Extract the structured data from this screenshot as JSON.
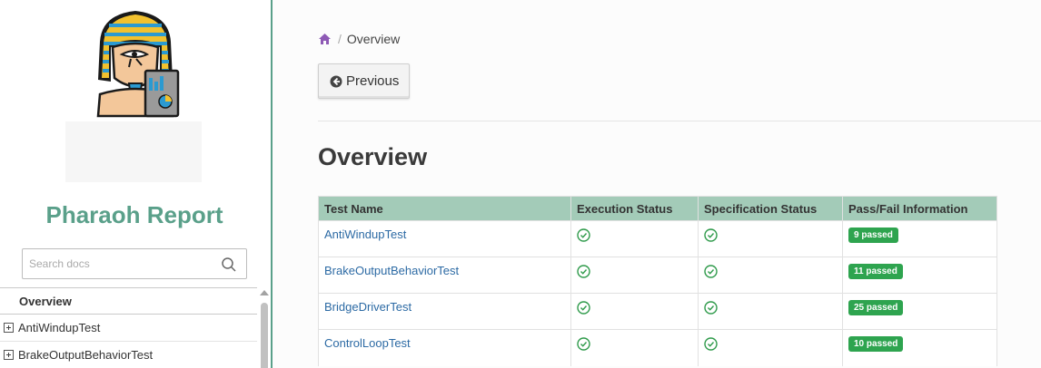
{
  "sidebar": {
    "project_name": "Pharaoh Report",
    "search_placeholder": "Search docs",
    "current_item": "Overview",
    "items": [
      {
        "label": "AntiWindupTest"
      },
      {
        "label": "BrakeOutputBehaviorTest"
      }
    ]
  },
  "breadcrumb": {
    "separator": "/",
    "current": "Overview"
  },
  "nav_buttons": {
    "previous_label": "Previous"
  },
  "page": {
    "title": "Overview"
  },
  "table": {
    "headers": [
      "Test Name",
      "Execution Status",
      "Specification Status",
      "Pass/Fail Information"
    ],
    "rows": [
      {
        "name": "AntiWindupTest",
        "badge": "9 passed"
      },
      {
        "name": "BrakeOutputBehaviorTest",
        "badge": "11 passed"
      },
      {
        "name": "BridgeDriverTest",
        "badge": "25 passed"
      },
      {
        "name": "ControlLoopTest",
        "badge": "10 passed"
      }
    ]
  },
  "colors": {
    "accent": "#5aa08a",
    "header_bg": "#a3cbb8",
    "badge_green": "#2ea44f",
    "link": "#2c6aa4",
    "breadcrumb_home": "#8e5ab5"
  },
  "icons": [
    "pharaoh-logo",
    "search-icon",
    "home-icon",
    "arrow-circle-left-icon",
    "check-circle-icon",
    "expand-plus-icon"
  ]
}
